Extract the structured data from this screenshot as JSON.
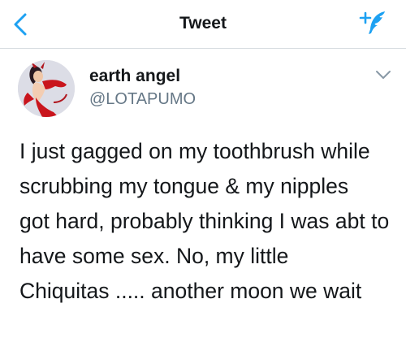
{
  "header": {
    "title": "Tweet",
    "back_icon": "chevron-left-icon",
    "compose_icon": "compose-tweet-icon",
    "accent_color": "#1da1f2"
  },
  "tweet": {
    "author": {
      "display_name": "earth angel",
      "handle": "@LOTAPUMO",
      "avatar": "illustrated devil figure avatar"
    },
    "menu_icon": "chevron-down-icon",
    "text": "I just gagged on my toothbrush while\nscrubbing my tongue & my nipples\ngot hard, probably thinking I was abt to\nhave some sex. No, my little\nChiquitas ..... another moon we wait"
  }
}
